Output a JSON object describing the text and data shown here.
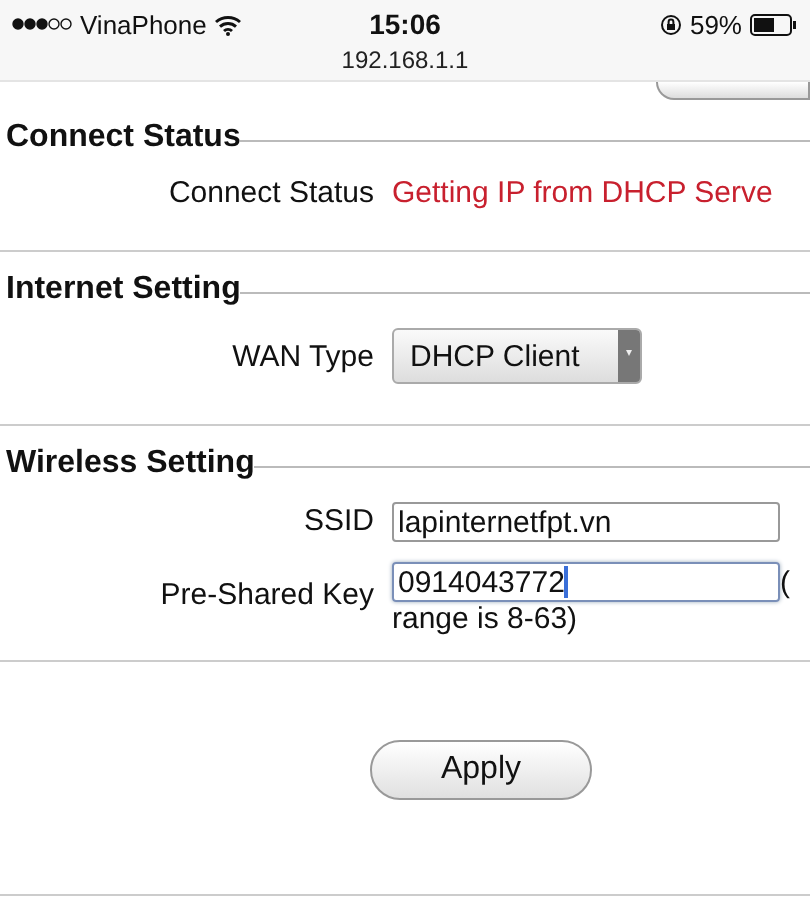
{
  "status_bar": {
    "carrier": "VinaPhone",
    "time": "15:06",
    "battery": "59%"
  },
  "address": "192.168.1.1",
  "sections": [
    {
      "title": "Connect Status",
      "rows": [
        {
          "kind": "status",
          "label": "Connect Status",
          "value": "Getting IP from DHCP Serve"
        }
      ]
    },
    {
      "title": "Internet Setting",
      "rows": [
        {
          "kind": "select",
          "label": "WAN Type",
          "value": "DHCP Client"
        }
      ]
    },
    {
      "title": "Wireless Setting",
      "rows": [
        {
          "kind": "input",
          "label": "SSID",
          "value": "lapinternetfpt.vn",
          "focused": false
        },
        {
          "kind": "input",
          "label": "Pre-Shared Key",
          "value": "0914043772",
          "focused": true,
          "hint": [
            "(",
            "range is 8-63)"
          ]
        }
      ]
    }
  ],
  "apply_button": "Apply"
}
